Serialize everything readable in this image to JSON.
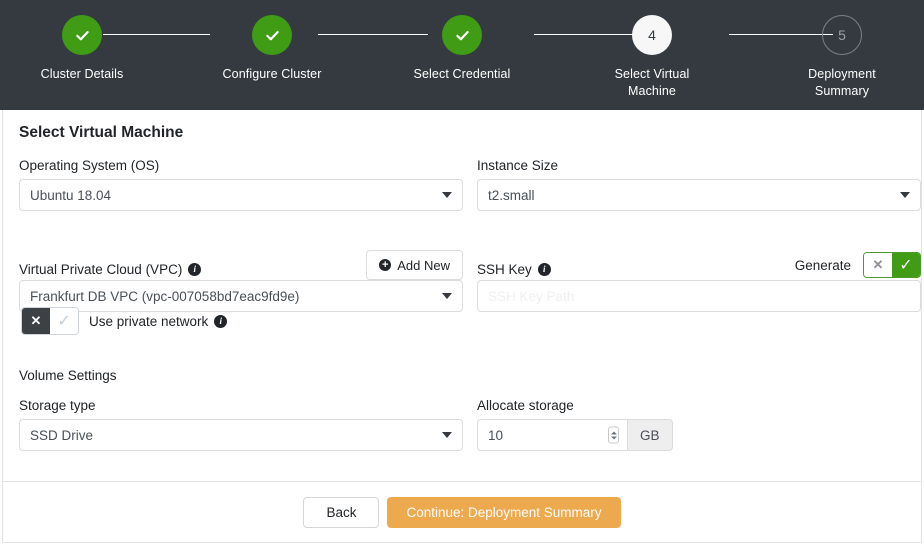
{
  "wizard": {
    "steps": [
      {
        "label": "Cluster Details",
        "state": "done",
        "marker": "check-icon"
      },
      {
        "label": "Configure Cluster",
        "state": "done",
        "marker": "check-icon"
      },
      {
        "label": "Select Credential",
        "state": "done",
        "marker": "check-icon"
      },
      {
        "label": "Select Virtual Machine",
        "state": "current",
        "marker": "4"
      },
      {
        "label": "Deployment Summary",
        "state": "todo",
        "marker": "5"
      }
    ],
    "colors": {
      "header_bg": "#343a40",
      "done": "#3f9c14",
      "current_bg": "#f7f7f7",
      "todo_outline": "#7b8184",
      "connector": "#ffffff"
    }
  },
  "form": {
    "title": "Select Virtual Machine",
    "os": {
      "label": "Operating System (OS)",
      "value": "Ubuntu 18.04"
    },
    "instance_size": {
      "label": "Instance Size",
      "value": "t2.small"
    },
    "vpc": {
      "label": "Virtual Private Cloud (VPC)",
      "value": "Frankfurt DB VPC (vpc-007058bd7eac9fd9e)",
      "add_new": "Add New"
    },
    "ssh_key": {
      "label": "SSH Key",
      "placeholder": "SSH Key Path",
      "value": "",
      "generate_label": "Generate",
      "generate_off": "✕",
      "generate_on": "✓",
      "generate_state": "on"
    },
    "private_network": {
      "label": "Use private network",
      "off": "✕",
      "on": "✓",
      "state": "off"
    },
    "volume": {
      "title": "Volume Settings",
      "storage_type": {
        "label": "Storage type",
        "value": "SSD Drive"
      },
      "allocate": {
        "label": "Allocate storage",
        "value": "10",
        "unit": "GB"
      }
    }
  },
  "footer": {
    "back": "Back",
    "continue": "Continue: Deployment Summary",
    "continue_color": "#eda94e"
  }
}
